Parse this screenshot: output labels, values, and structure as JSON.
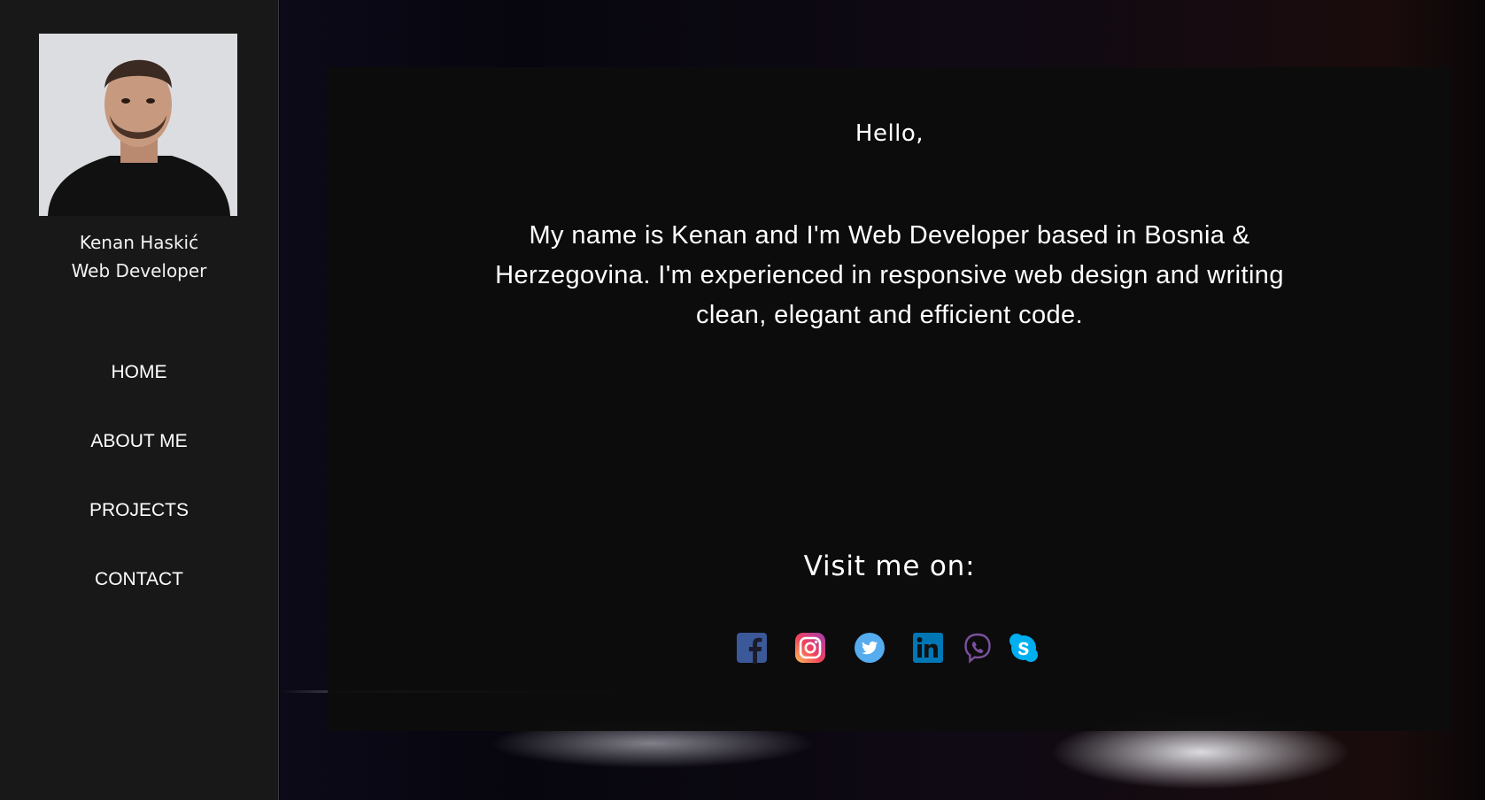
{
  "profile": {
    "name": "Kenan Haskić",
    "title": "Web Developer",
    "photo": "profile-photo"
  },
  "nav": {
    "items": [
      "HOME",
      "ABOUT ME",
      "PROJECTS",
      "CONTACT"
    ]
  },
  "main": {
    "greeting": "Hello,",
    "intro": "My name is Kenan and I'm Web Developer based in Bosnia & Herzegovina. I'm experienced in responsive web design and writing clean, elegant and efficient code.",
    "visit_heading": "Visit me on:",
    "socials": [
      {
        "icon": "facebook-icon",
        "color": "#3b5998"
      },
      {
        "icon": "instagram-icon",
        "color": "#e1306c"
      },
      {
        "icon": "twitter-icon",
        "color": "#55acee"
      },
      {
        "icon": "linkedin-icon",
        "color": "#0077b5"
      },
      {
        "icon": "viber-icon",
        "color": "#7b519d"
      },
      {
        "icon": "skype-icon",
        "color": "#00aff0"
      }
    ]
  },
  "colors": {
    "sidebar_bg": "#181818",
    "card_bg": "#0d0d0d",
    "text": "#ffffff"
  }
}
